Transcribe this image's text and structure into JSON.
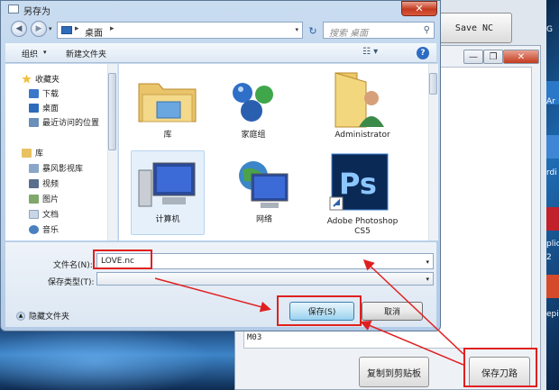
{
  "dialog": {
    "title": "另存为",
    "close": "✕",
    "nav": {
      "back": "◀",
      "forward": "▶",
      "dropdown": "▾"
    },
    "address": {
      "location": "桌面",
      "separator": "▸",
      "dropdown": "▾"
    },
    "refresh": "↻",
    "search": {
      "placeholder": "搜索 桌面",
      "icon": "⚲"
    },
    "toolbar": {
      "organize": "组织",
      "organize_arrow": "▾",
      "new_folder": "新建文件夹",
      "view": "☷ ▾",
      "help": "?"
    },
    "nav_pane": {
      "favorites": "收藏夹",
      "downloads": "下载",
      "desktop": "桌面",
      "recent": "最近访问的位置",
      "libraries": "库",
      "storm_video": "暴风影视库",
      "videos": "视频",
      "pictures": "图片",
      "documents": "文档",
      "music": "音乐"
    },
    "files": [
      {
        "label": "库"
      },
      {
        "label": "家庭组"
      },
      {
        "label": "Administrator"
      },
      {
        "label": "计算机"
      },
      {
        "label": "网络"
      },
      {
        "label": "Adobe Photoshop CS5"
      }
    ],
    "filename_label": "文件名(N):",
    "filename_value": "LOVE.nc",
    "filetype_label": "保存类型(T):",
    "filetype_value": "",
    "dropdown": "▾",
    "hide_folders": "隐藏文件夹",
    "hide_icon": "▲",
    "save": "保存(S)",
    "cancel": "取消"
  },
  "app": {
    "save_nc": "Save NC",
    "minimize": "—",
    "restore": "❐",
    "close": "✕",
    "log": "M03",
    "copy_clipboard": "复制到剪贴板",
    "save_toolpath": "保存刀路"
  },
  "desktop": {
    "side_labels": [
      "G",
      "Ar",
      "rdi",
      "plicG",
      "2",
      "epi"
    ]
  },
  "colors": {
    "highlight": "#e02020",
    "accent": "#3c7fb1"
  }
}
